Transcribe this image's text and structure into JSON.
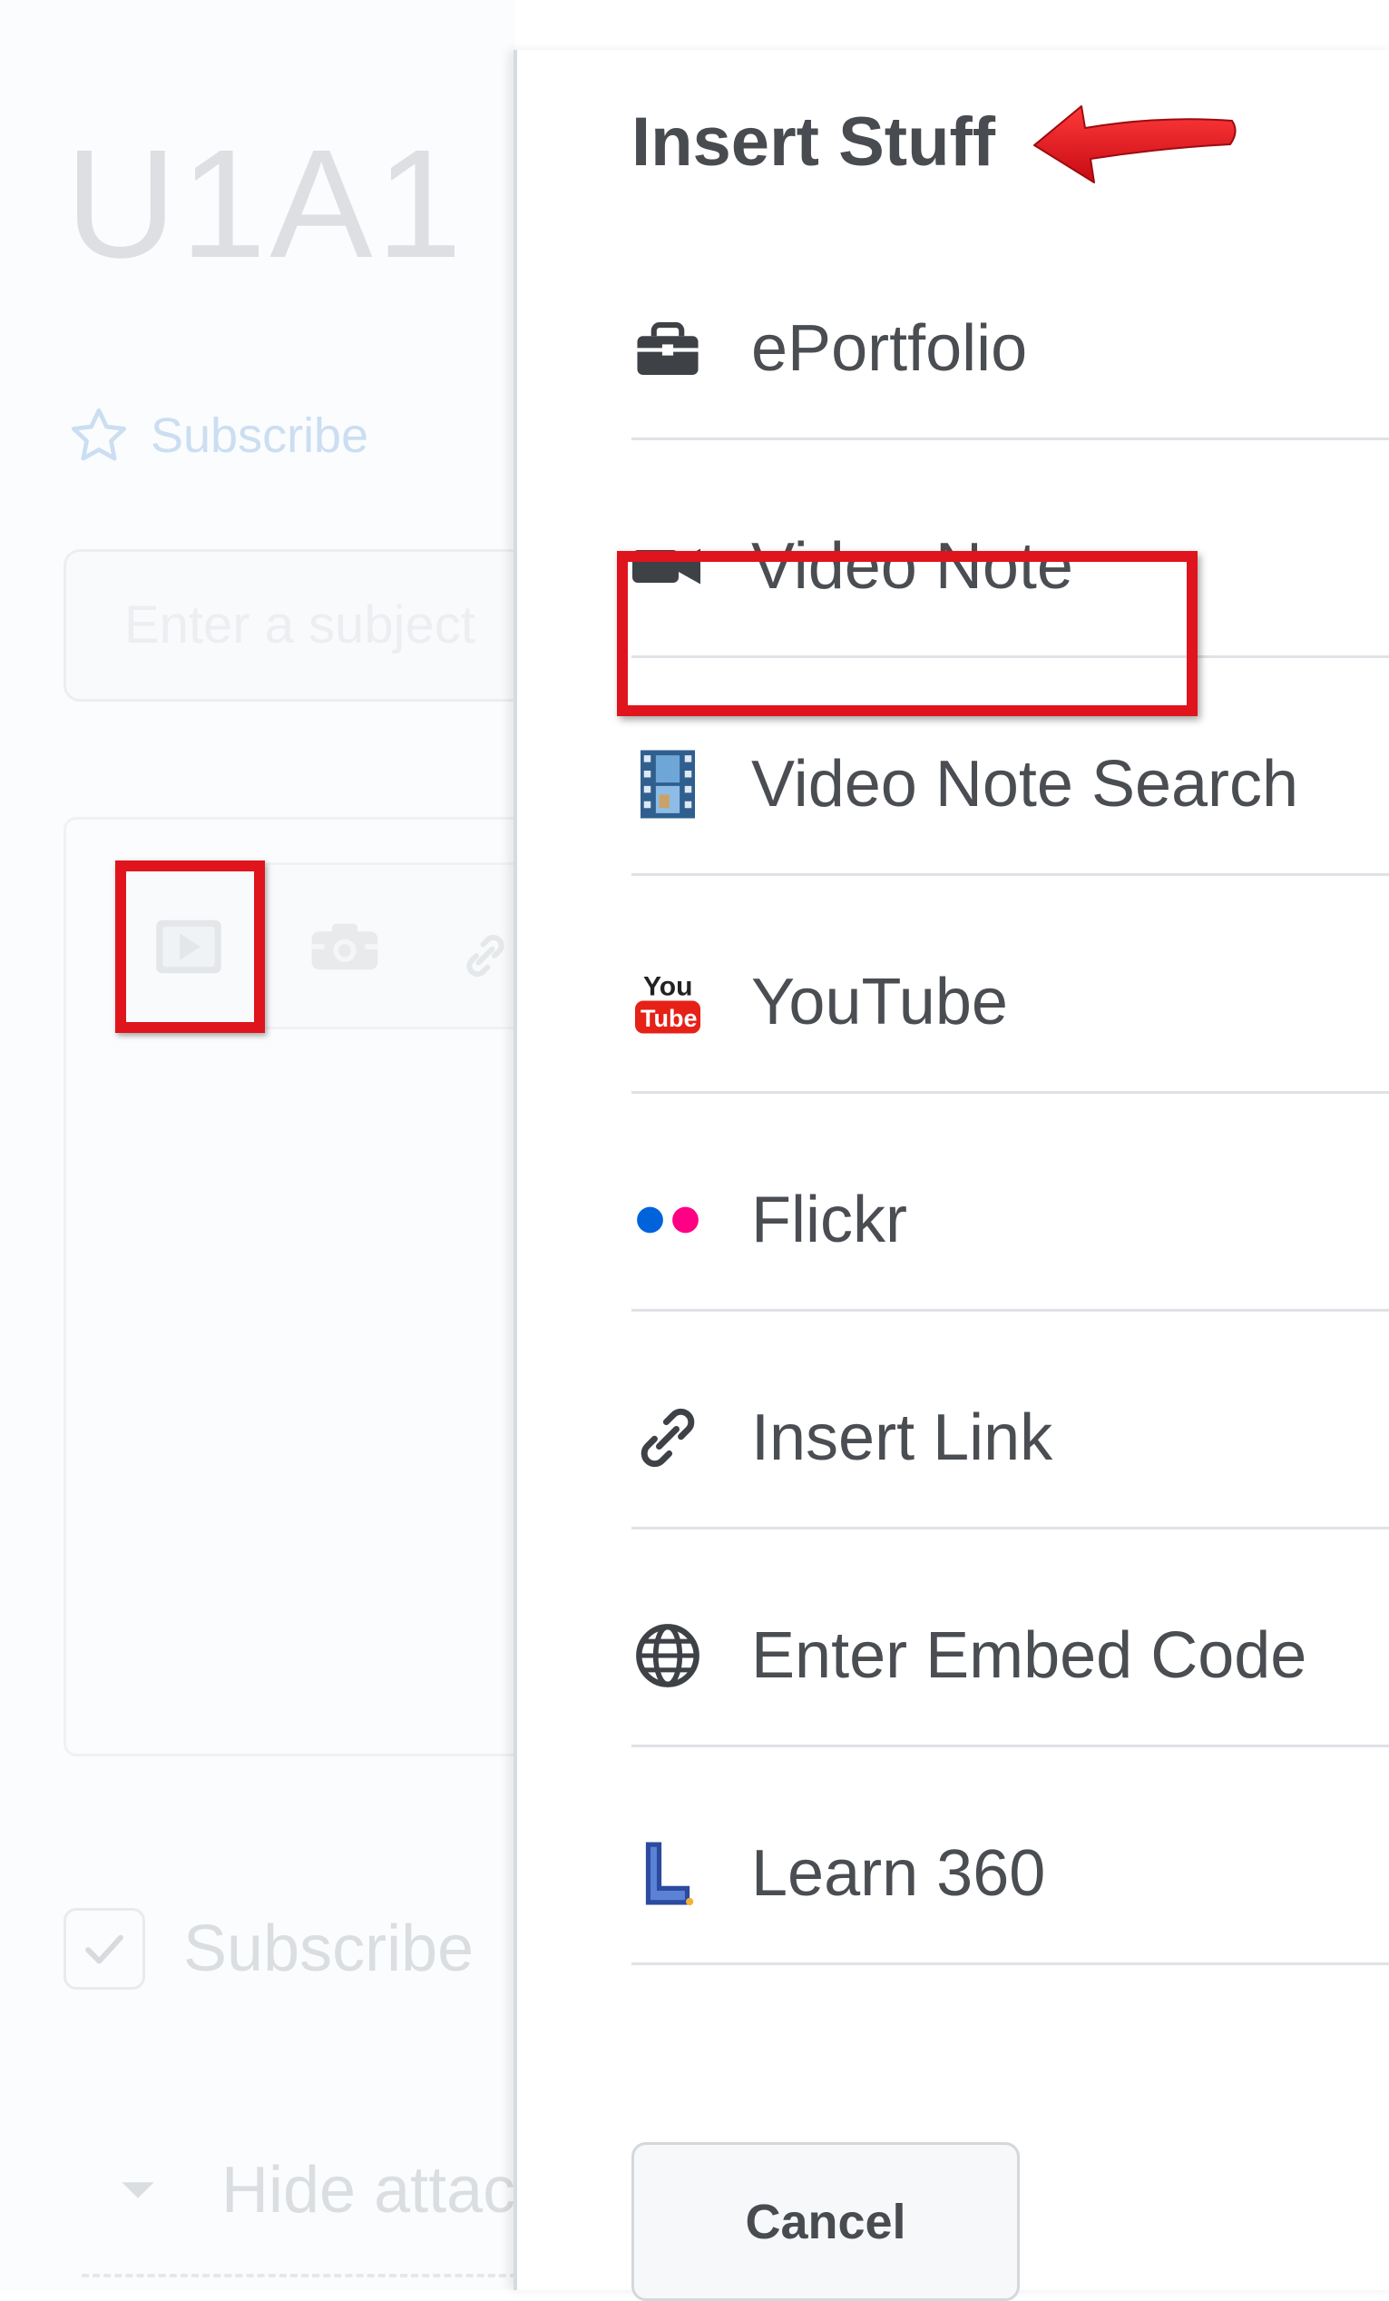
{
  "background": {
    "title": "U1A1 -",
    "subscribe_link": "Subscribe",
    "subject_placeholder": "Enter a subject",
    "checkbox_label": "Subscribe",
    "hide_attachments": "Hide attachments"
  },
  "dialog": {
    "title": "Insert Stuff",
    "items": [
      {
        "label": "ePortfolio",
        "icon": "briefcase-icon"
      },
      {
        "label": "Video Note",
        "icon": "video-camera-icon"
      },
      {
        "label": "Video Note Search",
        "icon": "film-strip-icon"
      },
      {
        "label": "YouTube",
        "icon": "youtube-icon"
      },
      {
        "label": "Flickr",
        "icon": "flickr-icon"
      },
      {
        "label": "Insert Link",
        "icon": "link-icon"
      },
      {
        "label": "Enter Embed Code",
        "icon": "globe-icon"
      },
      {
        "label": "Learn 360",
        "icon": "learn360-icon"
      }
    ],
    "cancel_label": "Cancel"
  },
  "colors": {
    "annotation_red": "#e0141d",
    "text_dark": "#4a4d52",
    "subscribe_blue": "#a8c8ec",
    "divider": "#dfe2e6"
  }
}
